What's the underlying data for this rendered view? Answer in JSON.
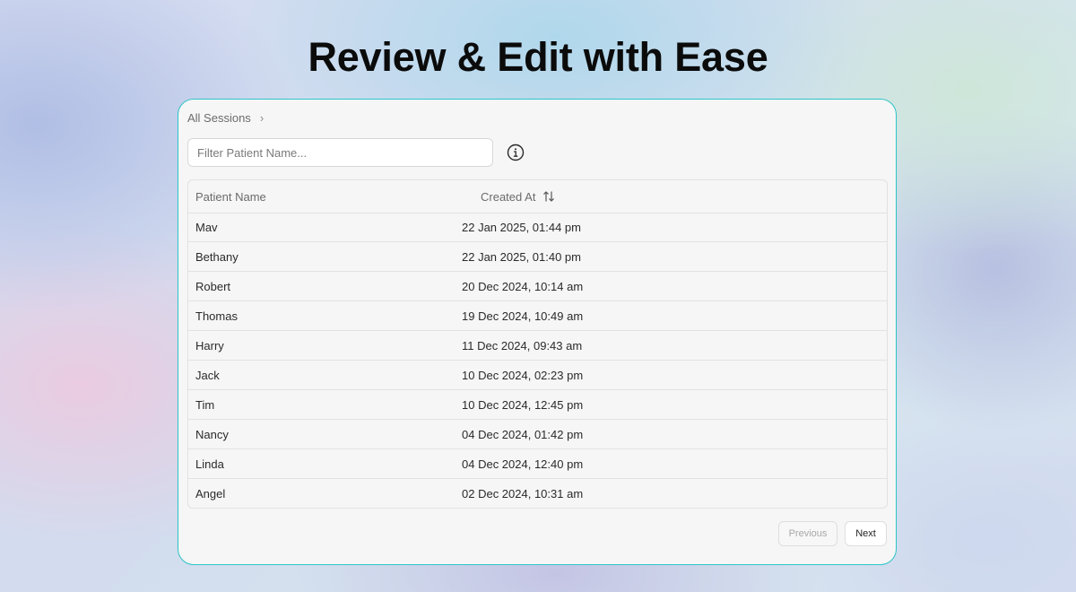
{
  "headline": "Review & Edit with Ease",
  "breadcrumb": {
    "label": "All Sessions",
    "separator": "›"
  },
  "filter": {
    "placeholder": "Filter Patient Name...",
    "value": ""
  },
  "table": {
    "columns": {
      "name": "Patient Name",
      "created": "Created At"
    },
    "rows": [
      {
        "name": "Mav",
        "created": "22 Jan 2025, 01:44 pm"
      },
      {
        "name": "Bethany",
        "created": "22 Jan 2025, 01:40 pm"
      },
      {
        "name": "Robert",
        "created": "20 Dec 2024, 10:14 am"
      },
      {
        "name": "Thomas",
        "created": "19 Dec 2024, 10:49 am"
      },
      {
        "name": "Harry",
        "created": "11 Dec 2024, 09:43 am"
      },
      {
        "name": "Jack",
        "created": "10 Dec 2024, 02:23 pm"
      },
      {
        "name": "Tim",
        "created": "10 Dec 2024, 12:45 pm"
      },
      {
        "name": "Nancy",
        "created": "04 Dec 2024, 01:42 pm"
      },
      {
        "name": "Linda",
        "created": "04 Dec 2024, 12:40 pm"
      },
      {
        "name": "Angel",
        "created": "02 Dec 2024, 10:31 am"
      }
    ]
  },
  "pagination": {
    "previous": "Previous",
    "next": "Next"
  },
  "icons": {
    "info": "info-circle-icon",
    "sort": "sort-arrows-icon",
    "breadcrumb_chevron": "chevron-right-icon"
  },
  "colors": {
    "card_border": "#2ec4c6",
    "card_bg": "#f6f6f6",
    "text": "#2a2a2a"
  }
}
